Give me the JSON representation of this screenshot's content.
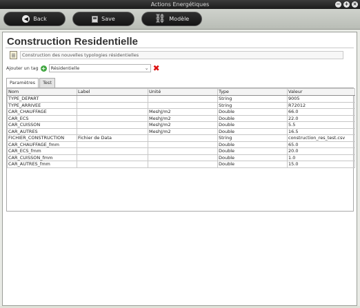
{
  "window": {
    "title": "Actions Energétiques"
  },
  "toolbar": {
    "back_label": "Back",
    "save_label": "Save",
    "model_label": "Modèle"
  },
  "page": {
    "title": "Construction Residentielle",
    "description": "Construction des nouvelles typologies résidentielles"
  },
  "tag": {
    "label": "Ajouter un tag",
    "selected": "Résidentielle"
  },
  "tabs": [
    {
      "label": "Paramètres"
    },
    {
      "label": "Test"
    }
  ],
  "table": {
    "columns": [
      "Nom",
      "Label",
      "Unité",
      "Type",
      "Valeur"
    ],
    "rows": [
      [
        "TYPE_DEPART",
        "",
        "",
        "String",
        "9005"
      ],
      [
        "TYPE_ARRIVEE",
        "",
        "",
        "String",
        "R72012"
      ],
      [
        "CAR_CHAUFFAGE",
        "",
        "MeshJ/m2",
        "Double",
        "66.0"
      ],
      [
        "CAR_ECS",
        "",
        "MeshJ/m2",
        "Double",
        "22.0"
      ],
      [
        "CAR_CUISSON",
        "",
        "MeshJ/m2",
        "Double",
        "5.5"
      ],
      [
        "CAR_AUTRES",
        "",
        "MeshJ/m2",
        "Double",
        "16.5"
      ],
      [
        "FICHIER_CONSTRUCTION",
        "Fichier de Data",
        "",
        "String",
        "construction_res_test.csv"
      ],
      [
        "CAR_CHAUFFAGE_fmm",
        "",
        "",
        "Double",
        "65.0"
      ],
      [
        "CAR_ECS_fmm",
        "",
        "",
        "Double",
        "20.0"
      ],
      [
        "CAR_CUISSON_fmm",
        "",
        "",
        "Double",
        "1.0"
      ],
      [
        "CAR_AUTRES_fmm",
        "",
        "",
        "Double",
        "15.0"
      ]
    ]
  }
}
